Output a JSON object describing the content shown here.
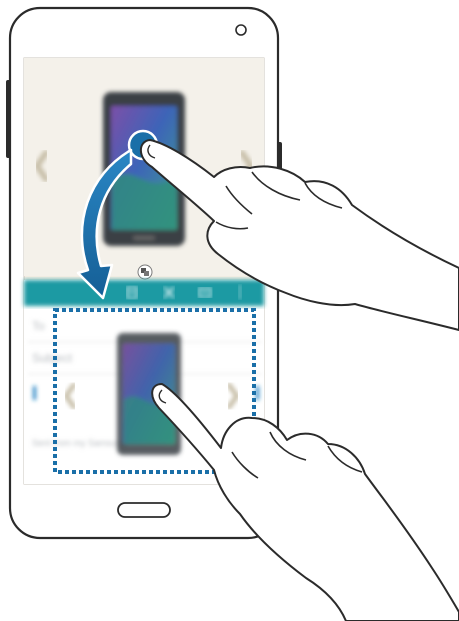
{
  "toolbar": {
    "accent": "#1f9aa3",
    "icons": [
      "save-icon",
      "close-icon",
      "send-icon",
      "more-icon"
    ]
  },
  "email": {
    "to_label": "To",
    "subject_label": "Subject",
    "signature": "Sent from my Samsung",
    "highlight_bar": "#1a7fc1"
  },
  "gesture": {
    "arrow_color": "#1a6fa8",
    "selection_border": "#1a6fa8"
  }
}
